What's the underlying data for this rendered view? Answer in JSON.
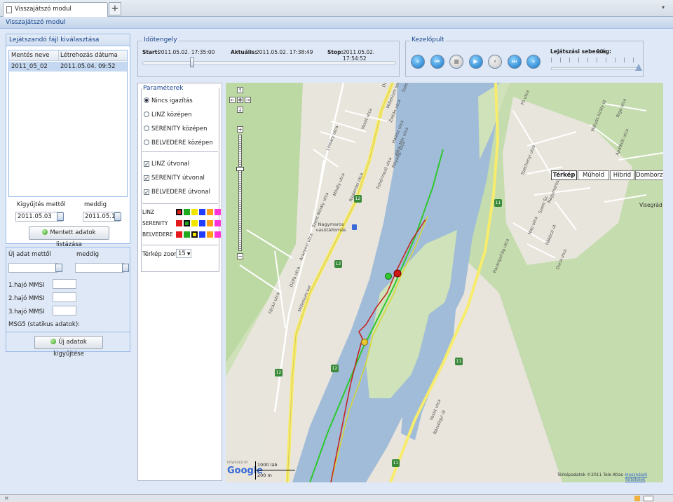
{
  "browser": {
    "tab_title": "Visszajátszó modul",
    "new_tab": "+",
    "tab_menu": "▾",
    "close": "×"
  },
  "module_title": "Visszajátszó modul",
  "file_panel": {
    "title": "Lejátszandó fájl kiválasztása",
    "columns": [
      "Mentés neve",
      "Létrehozás dátuma"
    ],
    "rows": [
      [
        "2011_05_02",
        "2011.05.04. 09:52"
      ]
    ],
    "from_label": "Kigyűjtés mettől",
    "to_label": "meddig",
    "from_value": "2011.05.03",
    "to_value": "2011.05.10",
    "list_button": "Mentett adatok listázása"
  },
  "new_panel": {
    "from_label": "Új adat mettől",
    "to_label": "meddig",
    "mmsi1": "1.hajó MMSI",
    "mmsi2": "2.hajó MMSI",
    "mmsi3": "3.hajó MMSI",
    "msg5": "MSG5 (statikus adatok):",
    "collect_button": "Új adatok kigyűjtése"
  },
  "timeline": {
    "legend": "Idötengely",
    "start_label": "Start:",
    "start_value": "2011.05.02. 17:35:00",
    "current_label": "Aktuális:",
    "current_value": "2011.05.02. 17:38:49",
    "stop_label": "Stop:",
    "stop_value": "2011.05.02. 17:54:52",
    "progress": 0.19
  },
  "control": {
    "legend": "Kezelőpult",
    "speed_label": "Lejátszási sebesség:",
    "speed_value": "10x",
    "speed_level": 1.0,
    "buttons": [
      {
        "name": "rewind-fast",
        "glyph": "«",
        "enabled": true
      },
      {
        "name": "skip-start",
        "glyph": "⏮",
        "enabled": true
      },
      {
        "name": "stop",
        "glyph": "■",
        "enabled": false
      },
      {
        "name": "play",
        "glyph": "▶",
        "enabled": true
      },
      {
        "name": "pause",
        "glyph": "⏸",
        "enabled": false
      },
      {
        "name": "skip-end",
        "glyph": "⏭",
        "enabled": true
      },
      {
        "name": "forward-fast",
        "glyph": "»",
        "enabled": true
      }
    ]
  },
  "params": {
    "legend": "Paraméterek",
    "radios": [
      {
        "label": "Nincs igazítás",
        "checked": true
      },
      {
        "label": "LINZ középen",
        "checked": false
      },
      {
        "label": "SERENITY középen",
        "checked": false
      },
      {
        "label": "BELVEDERE középen",
        "checked": false
      }
    ],
    "checks": [
      {
        "label": "LINZ útvonal",
        "checked": true
      },
      {
        "label": "SERENITY útvonal",
        "checked": true
      },
      {
        "label": "BELVEDERE útvonal",
        "checked": true
      }
    ],
    "ship_colors": [
      "LINZ",
      "SERENITY",
      "BELVEDERE"
    ],
    "palette": [
      "#e41a1c",
      "#1faa1f",
      "#f2e600",
      "#1f3cff",
      "#ff9f1a",
      "#ff33d6"
    ],
    "selected_color_index": [
      0,
      1,
      2
    ],
    "zoom_label": "Térkép zoom",
    "zoom_value": "15"
  },
  "map": {
    "types": [
      "Térkép",
      "Műhold",
      "Hibrid",
      "Domborzat"
    ],
    "active_type": "Térkép",
    "scale_ft": "1000 láb",
    "scale_m": "200 m",
    "powered_by": "POWERED BY",
    "google": "Google",
    "copyright": "Térképadatok ©2011 Tele Atlas -",
    "terms": "Használati feltételek",
    "town": "Visegrád",
    "station": "Nagymaros vasútállomás",
    "route_badges": [
      "12",
      "12",
      "12",
      "12",
      "11",
      "11",
      "11"
    ],
    "streets": [
      "Duna utca",
      "Millenium sor",
      "Széchenyi sétány",
      "Zoltán utca",
      "Halász utca",
      "Jókai Mór utca",
      "Pólyaági utca",
      "Fehérmezõ utca",
      "Vasút utca",
      "Lineáry utca",
      "Mihály utca",
      "Szent Mihály utca",
      "Aranyosi utca",
      "Diófa utca",
      "Fõ utca",
      "Széchenyi utca",
      "Nagymarosi utca",
      "Rigó utca",
      "Apátkúti utca",
      "Mátyás király út",
      "Szent Sz.",
      "Nap utca",
      "Rákóczi út",
      "Duna utca",
      "Harangvirág utca",
      "Vasút utca",
      "Rigóerdei utca",
      "Millenium sor",
      "Fácán utca",
      "Rézvölgyi út"
    ]
  }
}
